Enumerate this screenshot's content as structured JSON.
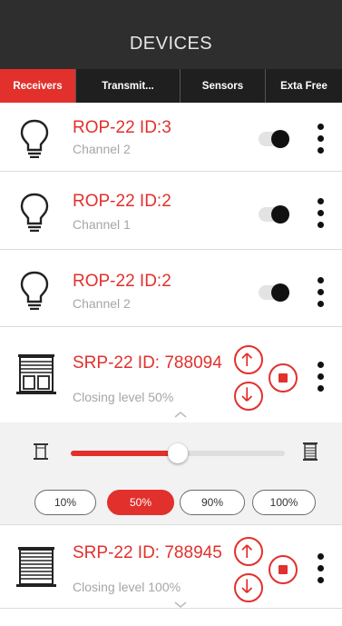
{
  "header": {
    "title": "DEVICES"
  },
  "tabs": [
    {
      "label": "Receivers",
      "active": true
    },
    {
      "label": "Transmit...",
      "active": false
    },
    {
      "label": "Sensors",
      "active": false
    },
    {
      "label": "Exta Free",
      "active": false
    }
  ],
  "devices": [
    {
      "title": "ROP-22 ID:3",
      "subtitle": "Channel 2",
      "icon": "bulb-icon",
      "toggle_on": true
    },
    {
      "title": "ROP-22 ID:2",
      "subtitle": "Channel 1",
      "icon": "bulb-icon",
      "toggle_on": true
    },
    {
      "title": "ROP-22 ID:2",
      "subtitle": "Channel 2",
      "icon": "bulb-icon",
      "toggle_on": true
    },
    {
      "title": "SRP-22 ID: 788094",
      "subtitle": "Closing level 50%",
      "icon": "window-blind-icon",
      "expanded": true
    },
    {
      "title": "SRP-22 ID: 788945",
      "subtitle": "Closing level 100%",
      "icon": "blind-closed-icon",
      "expanded": false
    }
  ],
  "blind_panel": {
    "level_percent": 50,
    "presets": [
      "10%",
      "50%",
      "90%",
      "100%"
    ],
    "selected_preset": "50%"
  },
  "colors": {
    "accent": "#e2302c",
    "header": "#2e2e2e",
    "tabbar": "#1f1f1f"
  }
}
